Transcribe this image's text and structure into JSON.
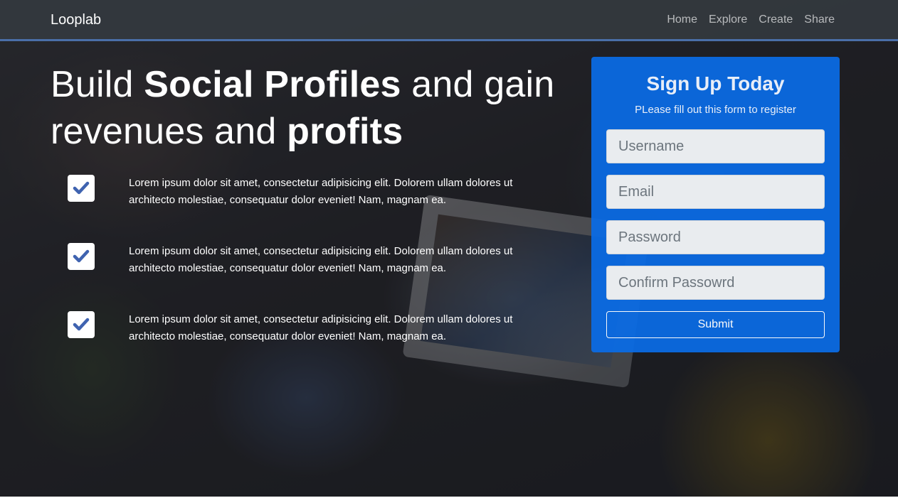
{
  "navbar": {
    "brand": "Looplab",
    "links": [
      "Home",
      "Explore",
      "Create",
      "Share"
    ]
  },
  "hero": {
    "headline": {
      "part1": "Build ",
      "bold1": "Social Profiles",
      "part2": " and gain revenues and ",
      "bold2": "profits"
    },
    "features": [
      {
        "text": "Lorem ipsum dolor sit amet, consectetur adipisicing elit. Dolorem ullam dolores ut architecto molestiae, consequatur dolor eveniet! Nam, magnam ea."
      },
      {
        "text": "Lorem ipsum dolor sit amet, consectetur adipisicing elit. Dolorem ullam dolores ut architecto molestiae, consequatur dolor eveniet! Nam, magnam ea."
      },
      {
        "text": "Lorem ipsum dolor sit amet, consectetur adipisicing elit. Dolorem ullam dolores ut architecto molestiae, consequatur dolor eveniet! Nam, magnam ea."
      }
    ]
  },
  "signup": {
    "title": "Sign Up Today",
    "subtitle": "PLease fill out this form to register",
    "fields": {
      "username": "Username",
      "email": "Email",
      "password": "Password",
      "confirm": "Confirm Passowrd"
    },
    "submit_label": "Submit"
  },
  "colors": {
    "card": "#0a6ce6",
    "check": "#3f63b0",
    "nav_border": "#4a6fa8"
  },
  "icons": {
    "feature_icon": "check-square-icon"
  }
}
